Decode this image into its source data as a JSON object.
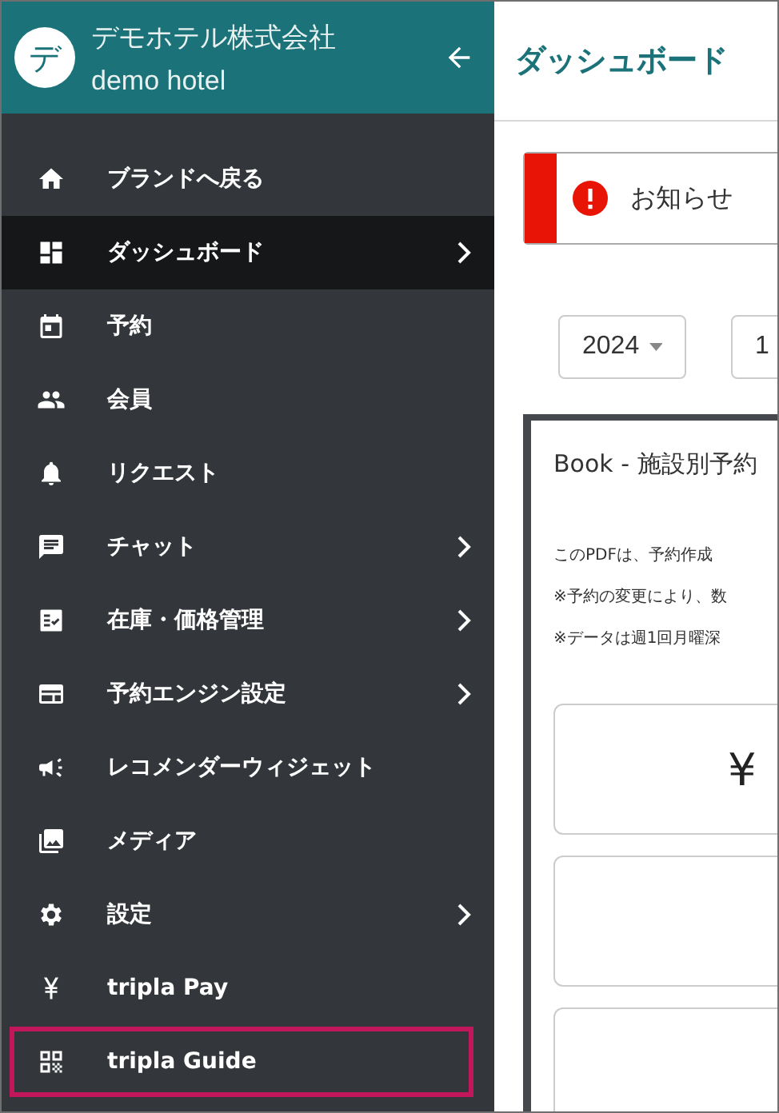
{
  "sidebar": {
    "avatar": "デ",
    "company": "デモホテル株式会社",
    "hotel": "demo hotel",
    "items": [
      {
        "label": "ブランドへ戻る",
        "submenu": false,
        "selected": false,
        "highlighted": false
      },
      {
        "label": "ダッシュボード",
        "submenu": true,
        "selected": true,
        "highlighted": false
      },
      {
        "label": "予約",
        "submenu": false,
        "selected": false,
        "highlighted": false
      },
      {
        "label": "会員",
        "submenu": false,
        "selected": false,
        "highlighted": false
      },
      {
        "label": "リクエスト",
        "submenu": false,
        "selected": false,
        "highlighted": false
      },
      {
        "label": "チャット",
        "submenu": true,
        "selected": false,
        "highlighted": false
      },
      {
        "label": "在庫・価格管理",
        "submenu": true,
        "selected": false,
        "highlighted": false
      },
      {
        "label": "予約エンジン設定",
        "submenu": true,
        "selected": false,
        "highlighted": false
      },
      {
        "label": "レコメンダーウィジェット",
        "submenu": false,
        "selected": false,
        "highlighted": false
      },
      {
        "label": "メディア",
        "submenu": false,
        "selected": false,
        "highlighted": false
      },
      {
        "label": "設定",
        "submenu": true,
        "selected": false,
        "highlighted": false
      },
      {
        "label": "tripla Pay",
        "submenu": false,
        "selected": false,
        "highlighted": false
      },
      {
        "label": "tripla Guide",
        "submenu": false,
        "selected": false,
        "highlighted": true
      }
    ]
  },
  "main": {
    "title": "ダッシュボード",
    "notice": "お知らせ",
    "filters": [
      {
        "value": "2024"
      },
      {
        "value": "1"
      }
    ],
    "report": {
      "title": "Book - 施設別予約",
      "notes": [
        "このPDFは、予約作成",
        "※予約の変更により、数",
        "※データは週1回月曜深"
      ],
      "stat_value": "¥"
    }
  }
}
